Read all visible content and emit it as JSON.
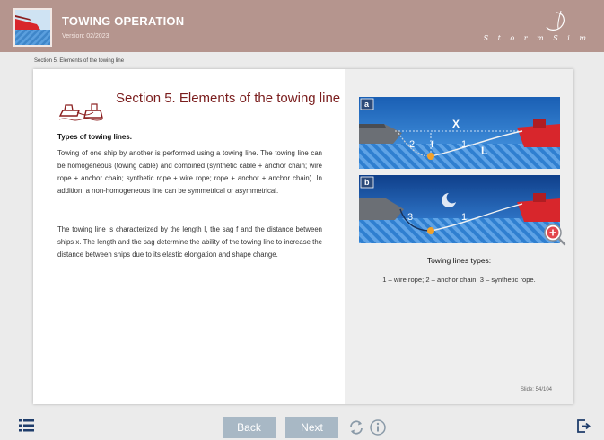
{
  "header": {
    "title": "TOWING OPERATION",
    "version": "Version: 02/2023",
    "brand_text": "S t o r m   S i m"
  },
  "breadcrumb": "Section 5. Elements of the towing line",
  "content": {
    "section_title": "Section 5. Elements of the towing line",
    "subheading": "Types of towing lines.",
    "paragraph1": "Towing of one ship by another is performed using a towing line. The towing line can be homogeneous (towing cable) and combined (synthetic cable + anchor chain; wire rope + anchor chain; synthetic rope + wire rope; rope + anchor + anchor chain). In addition, a non-homogeneous line can be symmetrical or asymmetrical.",
    "paragraph2": "The towing line is characterized by the length l, the sag f and the distance between ships x. The length and the sag determine the ability of the towing line to increase the distance between ships due to its elastic elongation and shape change."
  },
  "diagrams": {
    "a": {
      "tag": "a",
      "x_label": "X",
      "labels": [
        "2",
        "f",
        "1",
        "L"
      ]
    },
    "b": {
      "tag": "b",
      "labels": [
        "3",
        "1"
      ]
    },
    "caption": "Towing lines types:",
    "legend": "1 – wire rope; 2 – anchor chain; 3 – synthetic rope."
  },
  "slide_counter": "Slide: 54/104",
  "nav": {
    "back_label": "Back",
    "next_label": "Next"
  },
  "colors": {
    "header_bg": "#b5958e",
    "nav_button": "#a8b8c5",
    "section_title": "#7a1d1d",
    "ship_red": "#d8262c"
  },
  "icons": [
    "menu-icon",
    "replay-icon",
    "info-icon",
    "exit-icon",
    "zoom-in-icon"
  ]
}
